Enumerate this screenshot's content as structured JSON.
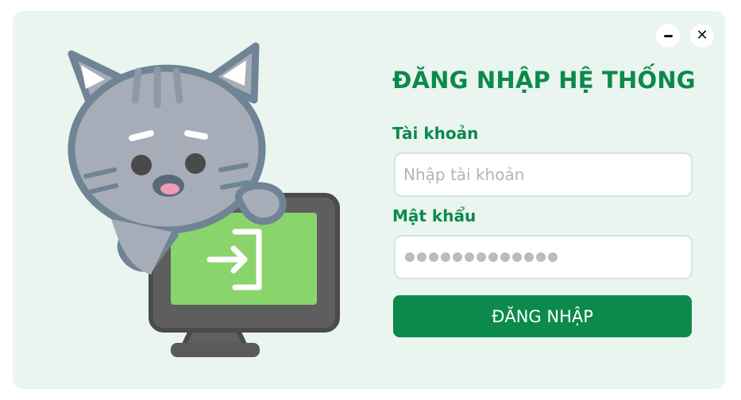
{
  "window": {
    "minimize_icon": "minimize-icon",
    "close_icon": "close-icon"
  },
  "illustration": {
    "icon": "cat-with-monitor-login-icon",
    "monitor_color": "#8ad46c"
  },
  "login": {
    "title": "ĐĂNG NHẬP HỆ THỐNG",
    "username_label": "Tài khoản",
    "username_placeholder": "Nhập tài khoản",
    "username_value": "",
    "password_label": "Mật khẩu",
    "password_mask_length": 13,
    "submit_label": "ĐĂNG NHẬP"
  },
  "colors": {
    "accent": "#0b8a4b",
    "background": "#eaf5ef"
  }
}
